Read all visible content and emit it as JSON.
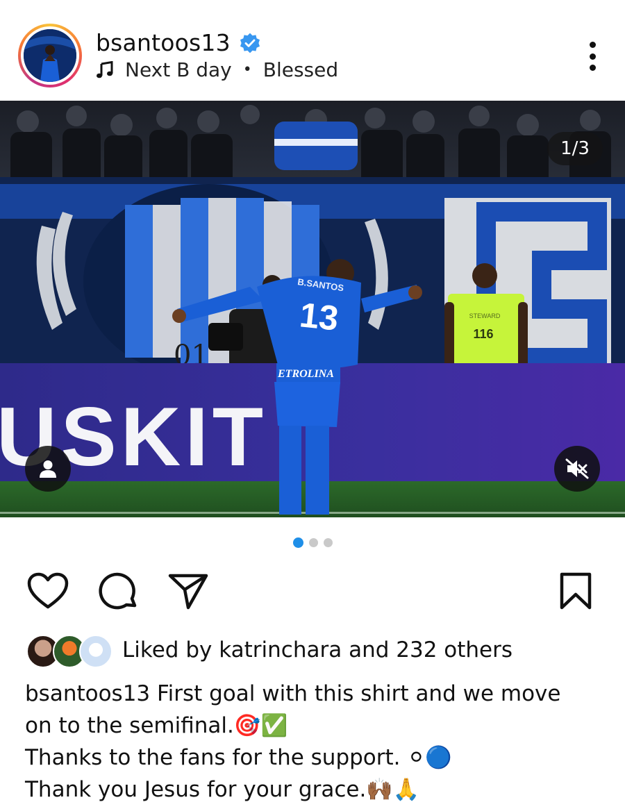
{
  "header": {
    "username": "bsantoos13",
    "verified_icon": "verified-badge-icon",
    "audio_track": "Next B day",
    "separator": "•",
    "location": "Blessed"
  },
  "media": {
    "counter": "1/3",
    "current_slide": 1,
    "total_slides": 3,
    "scene_text": {
      "player_name": "B.SANTOS",
      "player_number": "13",
      "sponsor": "ETROLINA",
      "steward_label": "STEWARD",
      "steward_number": "116",
      "board_text": "USKIT",
      "banner_number": "01"
    }
  },
  "actions": {
    "like_icon": "heart-icon",
    "comment_icon": "comment-icon",
    "share_icon": "share-icon",
    "save_icon": "bookmark-icon"
  },
  "likes": {
    "prefix": "Liked by",
    "user": "katrinchara",
    "suffix": "and 232 others"
  },
  "caption": {
    "username": "bsantoos13",
    "line1": "First goal with this shirt and we move",
    "line2": "on to the semifinal.🎯✅",
    "line3": "Thanks to the fans for the support. ⚪🔵",
    "line4": "Thank you Jesus for your grace.🙌🏾🙏"
  },
  "colors": {
    "accent_blue": "#1f8fe8",
    "verified_blue": "#3897f0",
    "kit_blue": "#1a5fd6"
  }
}
